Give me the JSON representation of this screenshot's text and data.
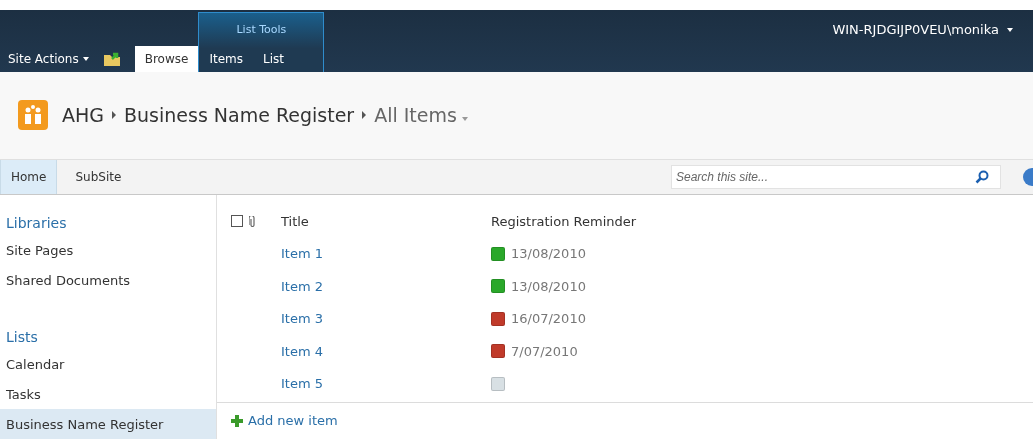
{
  "ribbon": {
    "site_actions": "Site Actions",
    "tabs": [
      {
        "label": "Browse",
        "selected": true
      }
    ],
    "context_group": {
      "title": "List Tools",
      "tabs": [
        {
          "label": "Items",
          "selected": false
        },
        {
          "label": "List",
          "selected": false
        }
      ]
    },
    "user": "WIN-RJDGIJP0VEU\\monika"
  },
  "breadcrumb": [
    "AHG",
    "Business Name Register",
    "All Items"
  ],
  "top_nav": [
    {
      "label": "Home",
      "selected": true
    },
    {
      "label": "SubSite",
      "selected": false
    }
  ],
  "search": {
    "placeholder": "Search this site..."
  },
  "sidebar": [
    {
      "heading": "Libraries",
      "items": [
        {
          "label": "Site Pages",
          "selected": false
        },
        {
          "label": "Shared Documents",
          "selected": false
        }
      ]
    },
    {
      "heading": "Lists",
      "items": [
        {
          "label": "Calendar",
          "selected": false
        },
        {
          "label": "Tasks",
          "selected": false
        },
        {
          "label": "Business Name Register",
          "selected": true
        }
      ]
    }
  ],
  "table": {
    "select_all": {
      "checked": false
    },
    "columns": [
      "Title",
      "Registration Reminder"
    ],
    "rows": [
      {
        "title": "Item 1",
        "reminder": "13/08/2010",
        "color": "#2aa82a"
      },
      {
        "title": "Item 2",
        "reminder": "13/08/2010",
        "color": "#2aa82a"
      },
      {
        "title": "Item 3",
        "reminder": "16/07/2010",
        "color": "#c03a2a"
      },
      {
        "title": "Item 4",
        "reminder": "7/07/2010",
        "color": "#c03a2a"
      },
      {
        "title": "Item 5",
        "color": "#d8e0e4"
      }
    ]
  },
  "add_item": "Add new item"
}
